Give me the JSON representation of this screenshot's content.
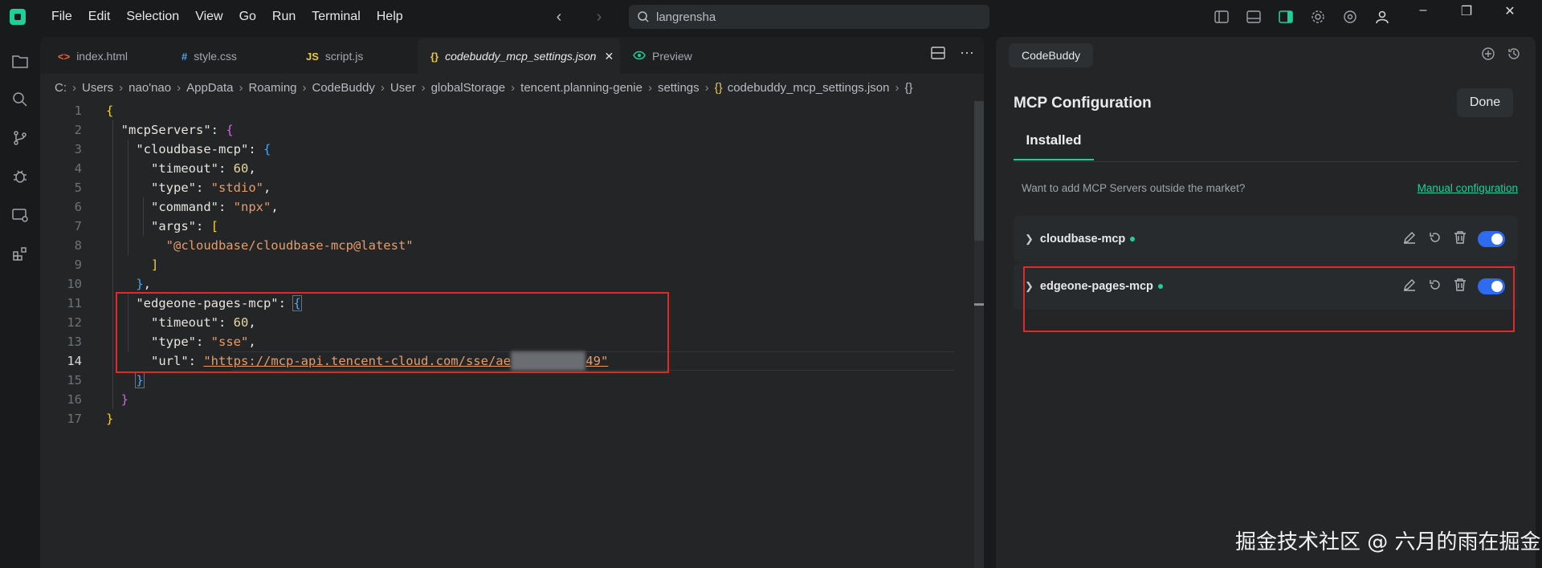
{
  "menu": [
    "File",
    "Edit",
    "Selection",
    "View",
    "Go",
    "Run",
    "Terminal",
    "Help"
  ],
  "search": {
    "value": "langrensha"
  },
  "tabs": [
    {
      "label": "index.html",
      "icon": "<>",
      "color": "#e8643c"
    },
    {
      "label": "style.css",
      "icon": "#",
      "color": "#4aa8f0"
    },
    {
      "label": "script.js",
      "icon": "JS",
      "color": "#e6c84a"
    },
    {
      "label": "codebuddy_mcp_settings.json",
      "icon": "{}",
      "color": "#e6c84a"
    },
    {
      "label": "Preview",
      "icon": "eye",
      "color": "#1fcf9a"
    }
  ],
  "breadcrumb": [
    "C:",
    "Users",
    "nao'nao",
    "AppData",
    "Roaming",
    "CodeBuddy",
    "User",
    "globalStorage",
    "tencent.planning-genie",
    "settings",
    "codebuddy_mcp_settings.json",
    "{}"
  ],
  "code": {
    "line_numbers": [
      "1",
      "2",
      "3",
      "4",
      "5",
      "6",
      "7",
      "8",
      "9",
      "10",
      "11",
      "12",
      "13",
      "14",
      "15",
      "16",
      "17"
    ],
    "mcpServers_key": "\"mcpServers\"",
    "cloudbase_key": "\"cloudbase-mcp\"",
    "timeout_key": "\"timeout\"",
    "timeout_val": "60",
    "type_key": "\"type\"",
    "type_val_stdio": "\"stdio\"",
    "command_key": "\"command\"",
    "command_val": "\"npx\"",
    "args_key": "\"args\"",
    "args_val": "\"@cloudbase/cloudbase-mcp@latest\"",
    "edgeone_key": "\"edgeone-pages-mcp\"",
    "type_val_sse": "\"sse\"",
    "url_key": "\"url\"",
    "url_prefix": "\"https://mcp-api.tencent-cloud.com/sse/ae",
    "url_suffix": "49\""
  },
  "panel": {
    "tab_label": "CodeBuddy",
    "title": "MCP Configuration",
    "done_label": "Done",
    "installed_label": "Installed",
    "hint": "Want to add MCP Servers outside the market?",
    "manual_link": "Manual configuration",
    "servers": [
      {
        "name": "cloudbase-mcp",
        "enabled": true
      },
      {
        "name": "edgeone-pages-mcp",
        "enabled": true
      }
    ]
  },
  "watermark": "掘金技术社区 @ 六月的雨在掘金",
  "colors": {
    "accent": "#1fcf9a",
    "toggle": "#2f6bf0",
    "highlight_box": "#e02a2a"
  }
}
